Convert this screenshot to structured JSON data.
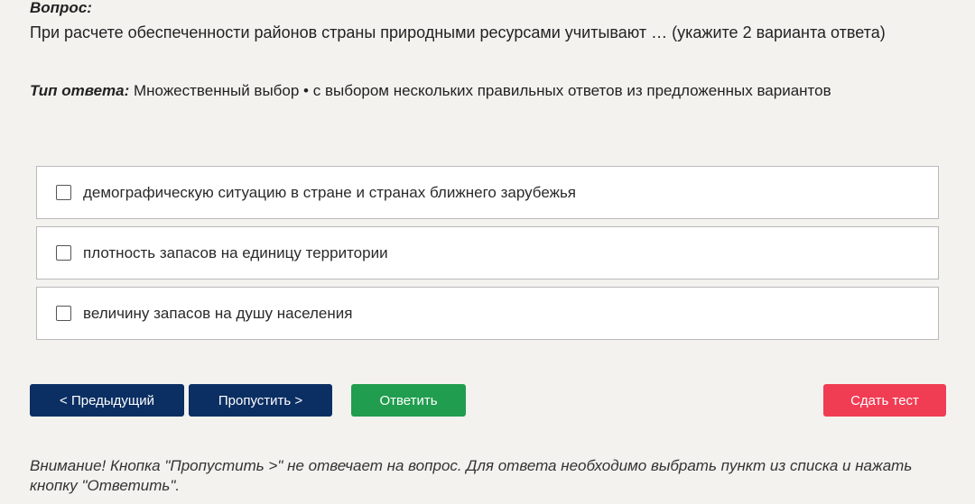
{
  "question": {
    "heading": "Вопрос:",
    "text": "При расчете обеспеченности районов страны природными ресурсами учитывают … (укажите 2 варианта ответа)"
  },
  "answer_type": {
    "label": "Тип ответа:",
    "value": "Множественный выбор • с выбором нескольких правильных ответов из предложенных вариантов"
  },
  "options": [
    {
      "label": "демографическую ситуацию в стране и странах ближнего зарубежья",
      "checked": false
    },
    {
      "label": "плотность запасов на единицу территории",
      "checked": false
    },
    {
      "label": "величину запасов на душу населения",
      "checked": false
    }
  ],
  "buttons": {
    "prev": "< Предыдущий",
    "skip": "Пропустить >",
    "answer": "Ответить",
    "submit": "Сдать тест"
  },
  "colors": {
    "navy": "#0b2f63",
    "green": "#219d4f",
    "red": "#f03d54"
  },
  "notice": "Внимание! Кнопка \"Пропустить >\" не отвечает на вопрос. Для ответа необходимо выбрать пункт из списка и нажать кнопку \"Ответить\"."
}
